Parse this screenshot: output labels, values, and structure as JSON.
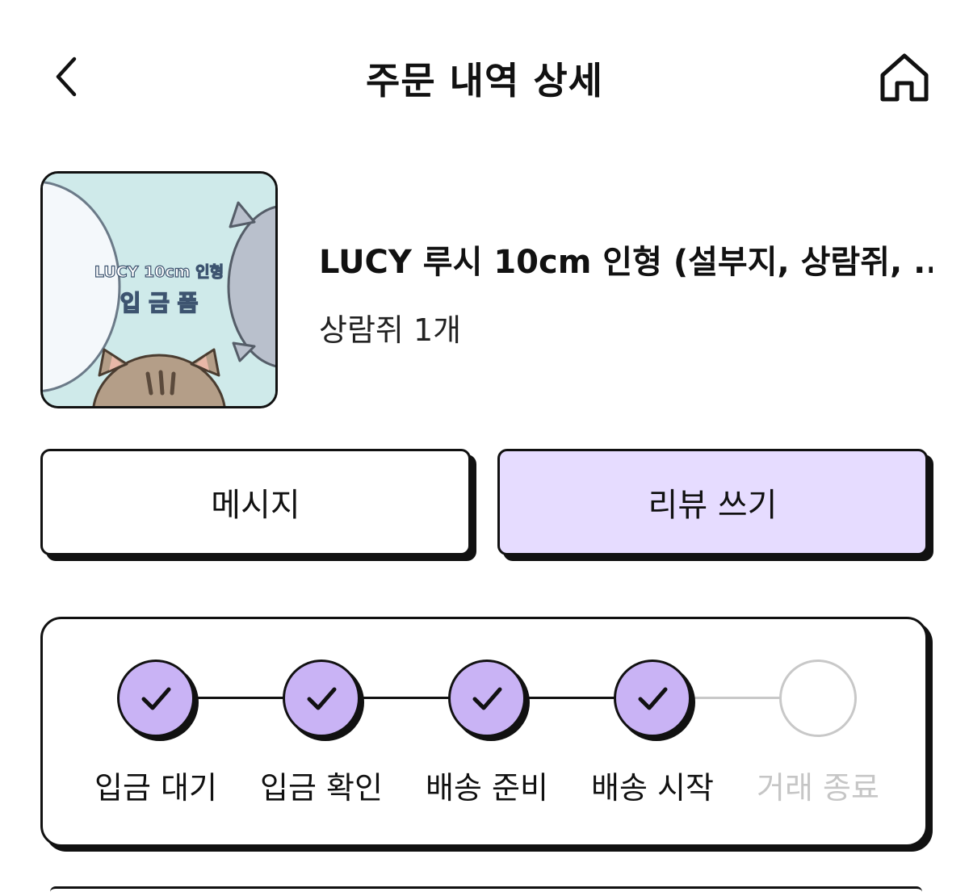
{
  "header": {
    "title": "주문 내역 상세",
    "back_icon": "chevron-left-icon",
    "home_icon": "home-icon"
  },
  "product": {
    "name": "LUCY 루시 10cm 인형 (설부지, 상람쥐, ...",
    "option": "상람쥐 1개",
    "thumbnail": {
      "line1": "LUCY 10cm 인형",
      "line2": "입 금 폼"
    }
  },
  "actions": {
    "message_label": "메시지",
    "review_label": "리뷰 쓰기"
  },
  "status": {
    "steps": [
      {
        "label": "입금 대기",
        "done": true
      },
      {
        "label": "입금 확인",
        "done": true
      },
      {
        "label": "배송 준비",
        "done": true
      },
      {
        "label": "배송 시작",
        "done": true
      },
      {
        "label": "거래 종료",
        "done": false
      }
    ]
  },
  "colors": {
    "accent": "#c9b3f5",
    "review_button": "#e6dcff",
    "inactive": "#c8c8c8",
    "thumbnail_bg": "#cfeaea"
  }
}
